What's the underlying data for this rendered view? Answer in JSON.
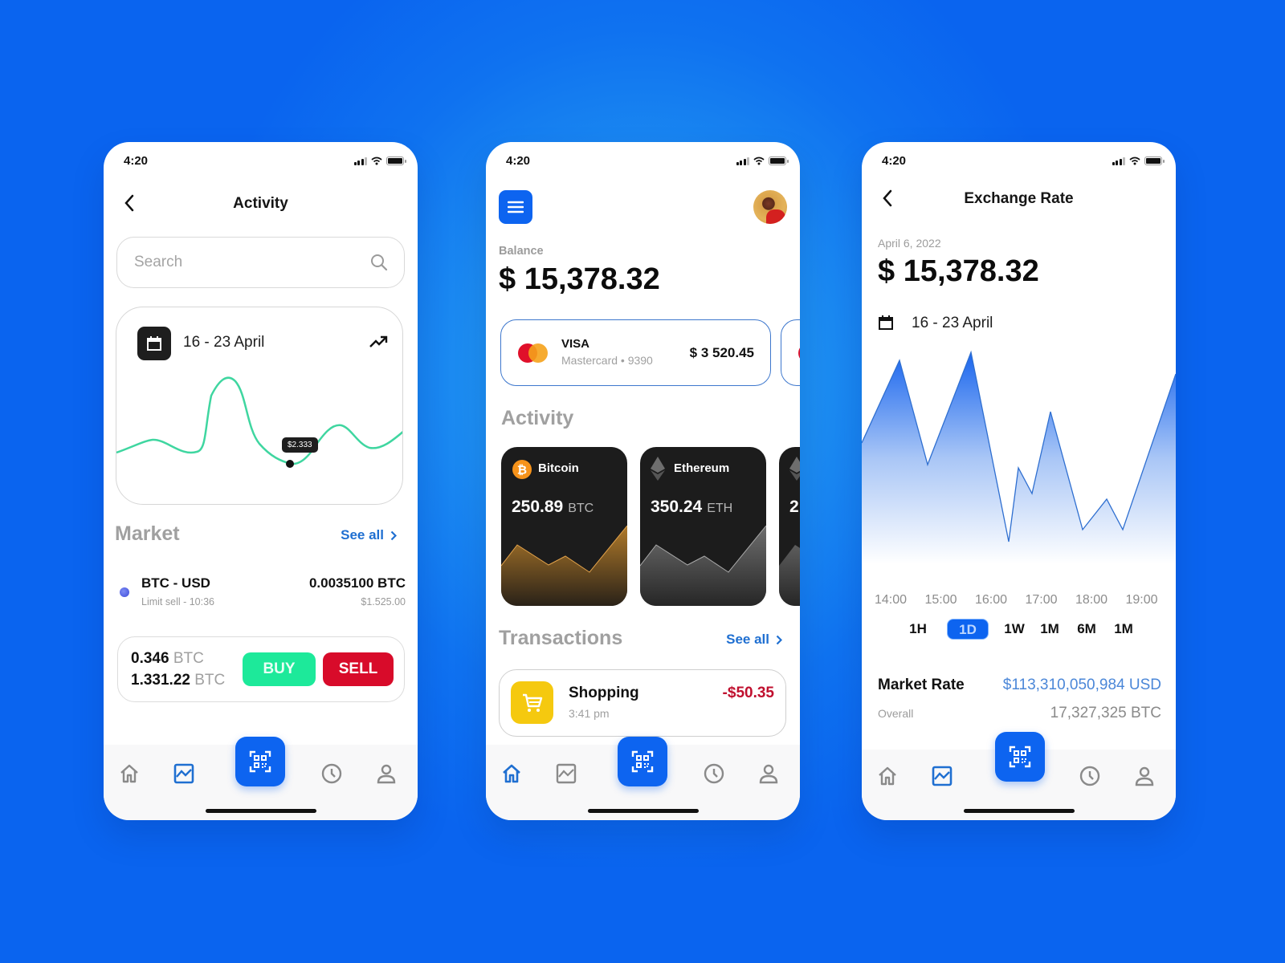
{
  "status_bar": {
    "time": "4:20"
  },
  "activity_screen": {
    "title": "Activity",
    "search": {
      "placeholder": "Search",
      "value": ""
    },
    "chart_card": {
      "date_range": "16 - 23 April",
      "tooltip_value": "$2.333"
    },
    "market": {
      "title": "Market",
      "see_all": "See all",
      "pair": "BTC - USD",
      "pair_sub": "Limit sell - 10:36",
      "amount": "0.0035100 BTC",
      "usd": "$1.525.00"
    },
    "trade": {
      "line1_value": "0.346",
      "line1_unit": "BTC",
      "line2_value": "1.331.22",
      "line2_unit": "BTC",
      "buy_label": "BUY",
      "sell_label": "SELL"
    },
    "nav_active": "chart"
  },
  "home_screen": {
    "balance_label": "Balance",
    "balance_amount": "$ 15,378.32",
    "cards": [
      {
        "brand": "VISA",
        "subtitle": "Mastercard • 9390",
        "amount": "$ 3 520.45"
      }
    ],
    "activity_title": "Activity",
    "coins": [
      {
        "name": "Bitcoin",
        "amount": "250.89",
        "unit": "BTC",
        "color": "#f7931a"
      },
      {
        "name": "Ethereum",
        "amount": "350.24",
        "unit": "ETH",
        "color": "#8a8a8a"
      },
      {
        "name": "",
        "amount": "2",
        "unit": "",
        "color": "#8a8a8a"
      }
    ],
    "transactions_title": "Transactions",
    "see_all": "See all",
    "transaction": {
      "title": "Shopping",
      "time": "3:41 pm",
      "amount": "-$50.35"
    },
    "nav_active": "home"
  },
  "exchange_screen": {
    "title": "Exchange Rate",
    "date": "April 6, 2022",
    "amount": "$ 15,378.32",
    "date_range": "16 - 23 April",
    "time_labels": [
      "14:00",
      "15:00",
      "16:00",
      "17:00",
      "18:00",
      "19:00"
    ],
    "range_tabs": [
      "1H",
      "1D",
      "1W",
      "1M",
      "6M",
      "1M"
    ],
    "active_range": "1D",
    "market_rate_label": "Market Rate",
    "market_rate_value": "$113,310,050,984 USD",
    "overall_label": "Overall",
    "overall_value": "17,327,325 BTC",
    "nav_active": "chart"
  },
  "colors": {
    "accent": "#0d64f0",
    "buy": "#1de99a",
    "sell": "#d80b2a",
    "link": "#1f6fd1",
    "negative": "#c0102f",
    "line_green": "#3fd6a0"
  }
}
